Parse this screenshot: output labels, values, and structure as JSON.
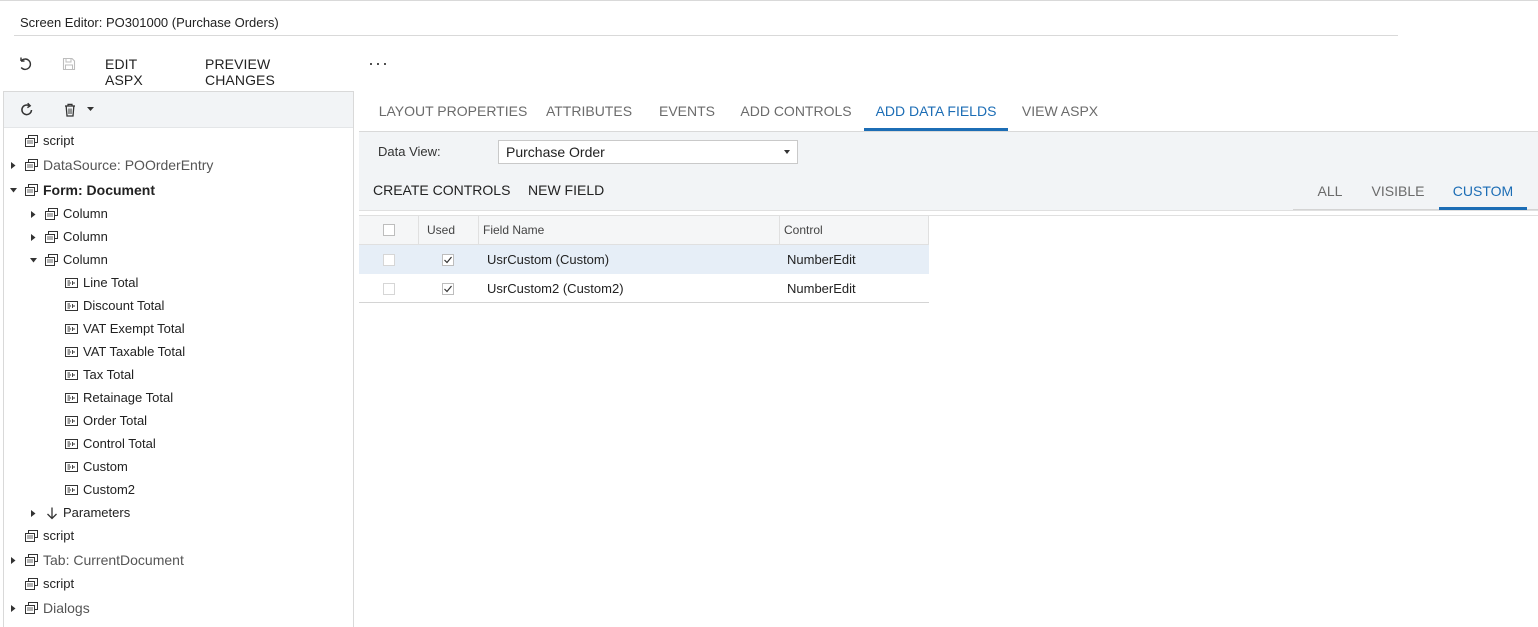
{
  "window": {
    "title": "Screen Editor: PO301000 (Purchase Orders)"
  },
  "toolbar": {
    "undo_icon": "undo-icon",
    "save_icon": "save-icon",
    "edit_aspx": "EDIT ASPX",
    "preview_changes": "PREVIEW CHANGES",
    "more": "···"
  },
  "tree": {
    "toolbar_icons": [
      "refresh-icon",
      "trash-icon",
      "caret-down-icon"
    ],
    "items": [
      {
        "label": "script",
        "style": "sm",
        "icon": "container-icon",
        "expander": "none"
      },
      {
        "label": "DataSource: POOrderEntry",
        "style": "big",
        "icon": "container-icon",
        "expander": "collapsed"
      },
      {
        "label": "Form: Document",
        "style": "bold",
        "icon": "container-icon",
        "expander": "expanded"
      },
      {
        "label": "Column",
        "style": "sm",
        "icon": "container-icon",
        "expander": "collapsed"
      },
      {
        "label": "Column",
        "style": "sm",
        "icon": "container-icon",
        "expander": "collapsed"
      },
      {
        "label": "Column",
        "style": "sm",
        "icon": "container-icon",
        "expander": "expanded"
      },
      {
        "label": "Line Total",
        "style": "sm",
        "icon": "field-icon",
        "expander": "none"
      },
      {
        "label": "Discount Total",
        "style": "sm",
        "icon": "field-icon",
        "expander": "none"
      },
      {
        "label": "VAT Exempt Total",
        "style": "sm",
        "icon": "field-icon",
        "expander": "none"
      },
      {
        "label": "VAT Taxable Total",
        "style": "sm",
        "icon": "field-icon",
        "expander": "none"
      },
      {
        "label": "Tax Total",
        "style": "sm",
        "icon": "field-icon",
        "expander": "none"
      },
      {
        "label": "Retainage Total",
        "style": "sm",
        "icon": "field-icon",
        "expander": "none"
      },
      {
        "label": "Order Total",
        "style": "sm",
        "icon": "field-icon",
        "expander": "none"
      },
      {
        "label": "Control Total",
        "style": "sm",
        "icon": "field-icon",
        "expander": "none"
      },
      {
        "label": "Custom",
        "style": "sm",
        "icon": "field-icon",
        "expander": "none"
      },
      {
        "label": "Custom2",
        "style": "sm",
        "icon": "field-icon",
        "expander": "none"
      },
      {
        "label": "Parameters",
        "style": "sm",
        "icon": "down-arrow-icon",
        "expander": "collapsed"
      },
      {
        "label": "script",
        "style": "sm",
        "icon": "container-icon",
        "expander": "none"
      },
      {
        "label": "Tab: CurrentDocument",
        "style": "big",
        "icon": "container-icon",
        "expander": "collapsed"
      },
      {
        "label": "script",
        "style": "sm",
        "icon": "container-icon",
        "expander": "none"
      },
      {
        "label": "Dialogs",
        "style": "big",
        "icon": "container-icon",
        "expander": "collapsed"
      }
    ]
  },
  "tabs": [
    {
      "label": "LAYOUT PROPERTIES",
      "active": false
    },
    {
      "label": "ATTRIBUTES",
      "active": false
    },
    {
      "label": "EVENTS",
      "active": false
    },
    {
      "label": "ADD CONTROLS",
      "active": false
    },
    {
      "label": "ADD DATA FIELDS",
      "active": true
    },
    {
      "label": "VIEW ASPX",
      "active": false
    }
  ],
  "form": {
    "data_view_label": "Data View:",
    "data_view_value": "Purchase Order",
    "create_controls": "CREATE CONTROLS",
    "new_field": "NEW FIELD",
    "filters": [
      {
        "label": "ALL",
        "active": false
      },
      {
        "label": "VISIBLE",
        "active": false
      },
      {
        "label": "CUSTOM",
        "active": true
      }
    ]
  },
  "grid": {
    "headers": {
      "used": "Used",
      "field_name": "Field Name",
      "control": "Control"
    },
    "rows": [
      {
        "field_name": "UsrCustom (Custom)",
        "used": true,
        "control": "NumberEdit",
        "selected": true
      },
      {
        "field_name": "UsrCustom2 (Custom2)",
        "used": true,
        "control": "NumberEdit",
        "selected": false
      }
    ]
  },
  "colors": {
    "accent": "#1c6db5",
    "selected_row": "#e6eef7",
    "panel_bg": "#f2f4f6"
  }
}
